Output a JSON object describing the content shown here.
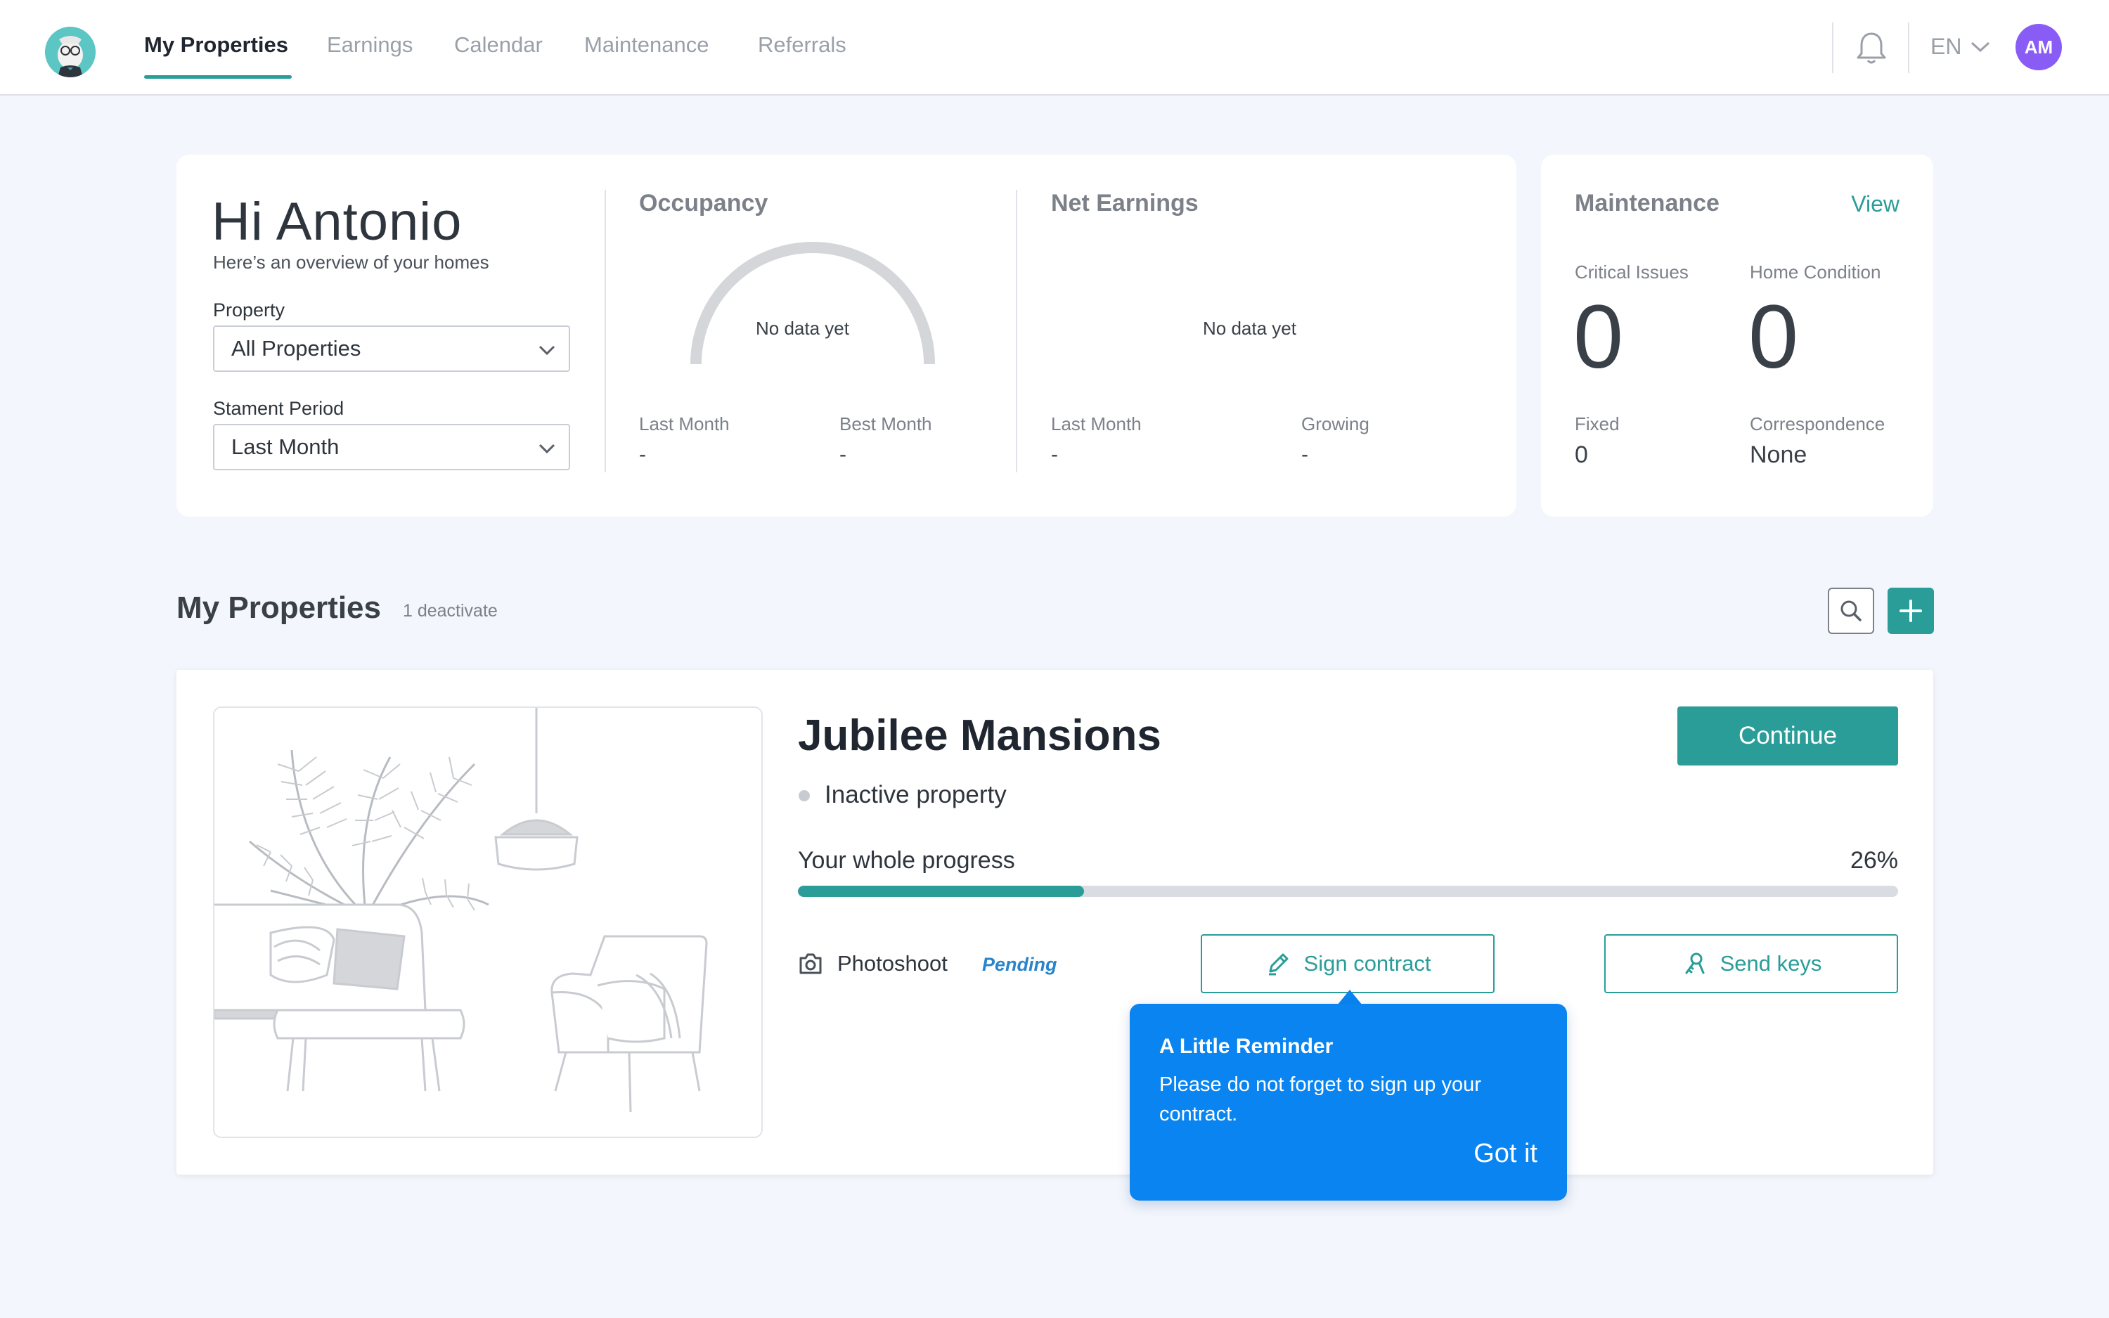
{
  "nav": {
    "tabs": [
      {
        "label": "My Properties",
        "active": true
      },
      {
        "label": "Earnings"
      },
      {
        "label": "Calendar"
      },
      {
        "label": "Maintenance"
      },
      {
        "label": "Referrals"
      }
    ],
    "language": "EN",
    "avatar_initials": "AM"
  },
  "overview": {
    "greeting": "Hi Antonio",
    "subtitle": "Here’s an overview of your homes",
    "property_label": "Property",
    "property_value": "All Properties",
    "period_label": "Stament Period",
    "period_value": "Last Month",
    "occupancy": {
      "title": "Occupancy",
      "empty": "No data yet",
      "last_month_label": "Last Month",
      "last_month_value": "-",
      "best_month_label": "Best Month",
      "best_month_value": "-"
    },
    "net_earnings": {
      "title": "Net Earnings",
      "empty": "No data yet",
      "last_month_label": "Last Month",
      "last_month_value": "-",
      "growing_label": "Growing",
      "growing_value": "-"
    }
  },
  "maintenance": {
    "title": "Maintenance",
    "view_label": "View",
    "critical_label": "Critical Issues",
    "critical_value": "0",
    "condition_label": "Home Condition",
    "condition_value": "0",
    "fixed_label": "Fixed",
    "fixed_value": "0",
    "correspondence_label": "Correspondence",
    "correspondence_value": "None"
  },
  "properties": {
    "title": "My Properties",
    "subtitle": "1 deactivate",
    "items": [
      {
        "name": "Jubilee Mansions",
        "status": "Inactive property",
        "continue_label": "Continue",
        "progress_label": "Your whole progress",
        "progress_percent": 26,
        "progress_text": "26%",
        "photoshoot_label": "Photoshoot",
        "photoshoot_status": "Pending",
        "sign_label": "Sign contract",
        "keys_label": "Send keys"
      }
    ]
  },
  "tooltip": {
    "title": "A Little Reminder",
    "body": "Please do not forget to sign up your contract.",
    "button": "Got it"
  },
  "colors": {
    "accent": "#2a9d99",
    "tooltip": "#0a84f0",
    "avatar": "#8a5cf6",
    "pending": "#2a84c9"
  }
}
